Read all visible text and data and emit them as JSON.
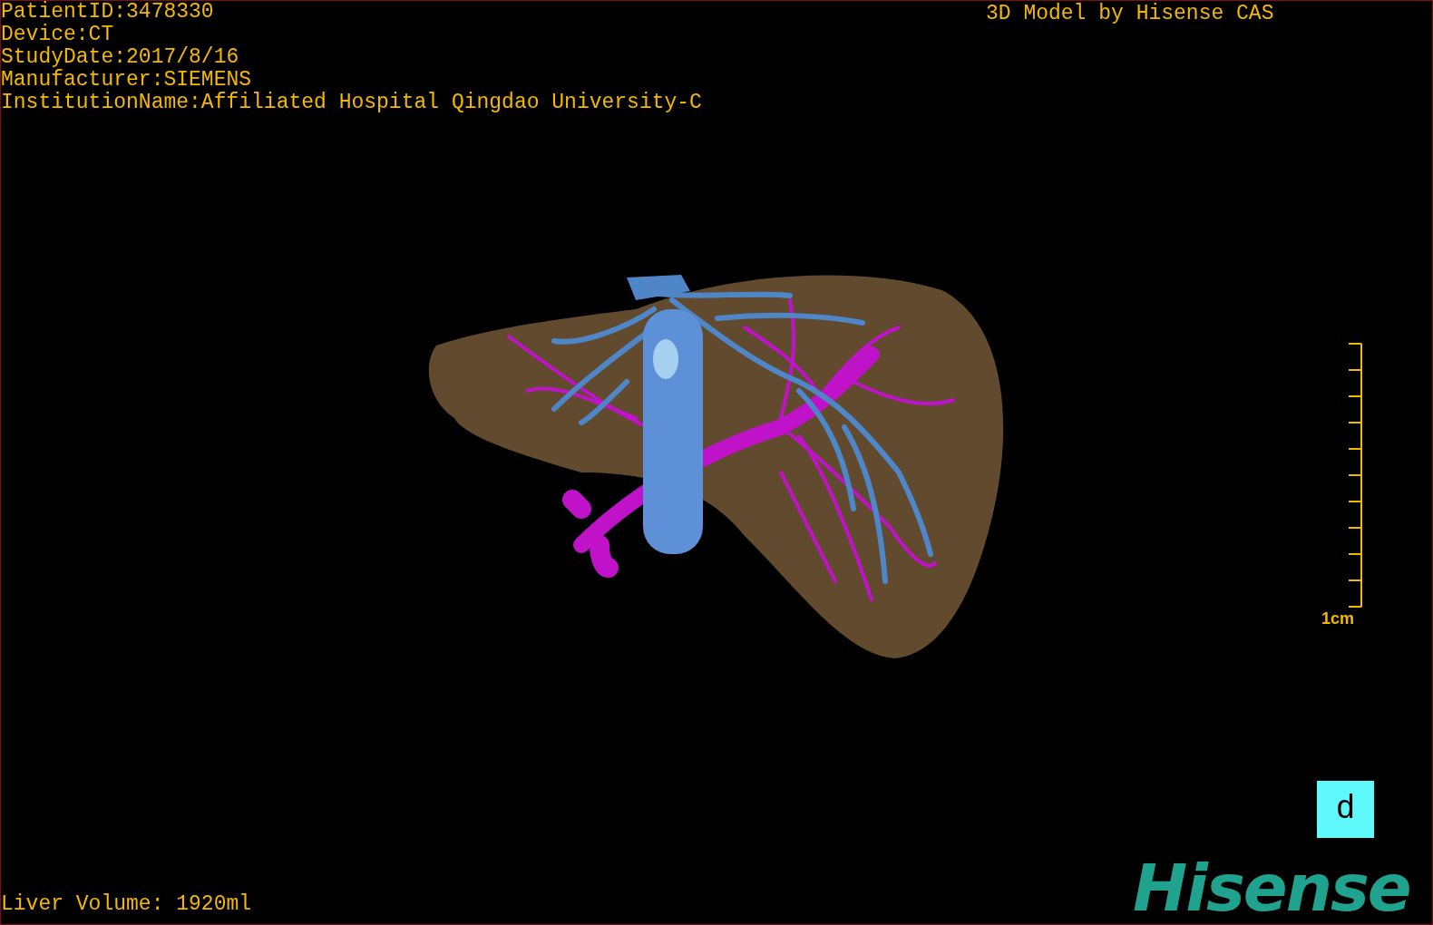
{
  "info_lines": [
    "PatientID:3478330",
    "Device:CT",
    "StudyDate:2017/8/16",
    "Manufacturer:SIEMENS",
    "InstitutionName:Affiliated Hospital Qingdao University-C"
  ],
  "caption": "3D Model by Hisense CAS",
  "scale_bar": {
    "label": "1cm"
  },
  "orientation_cube": {
    "label": "d"
  },
  "liver_volume": "Liver Volume: 1920ml",
  "logo": "Hisense"
}
